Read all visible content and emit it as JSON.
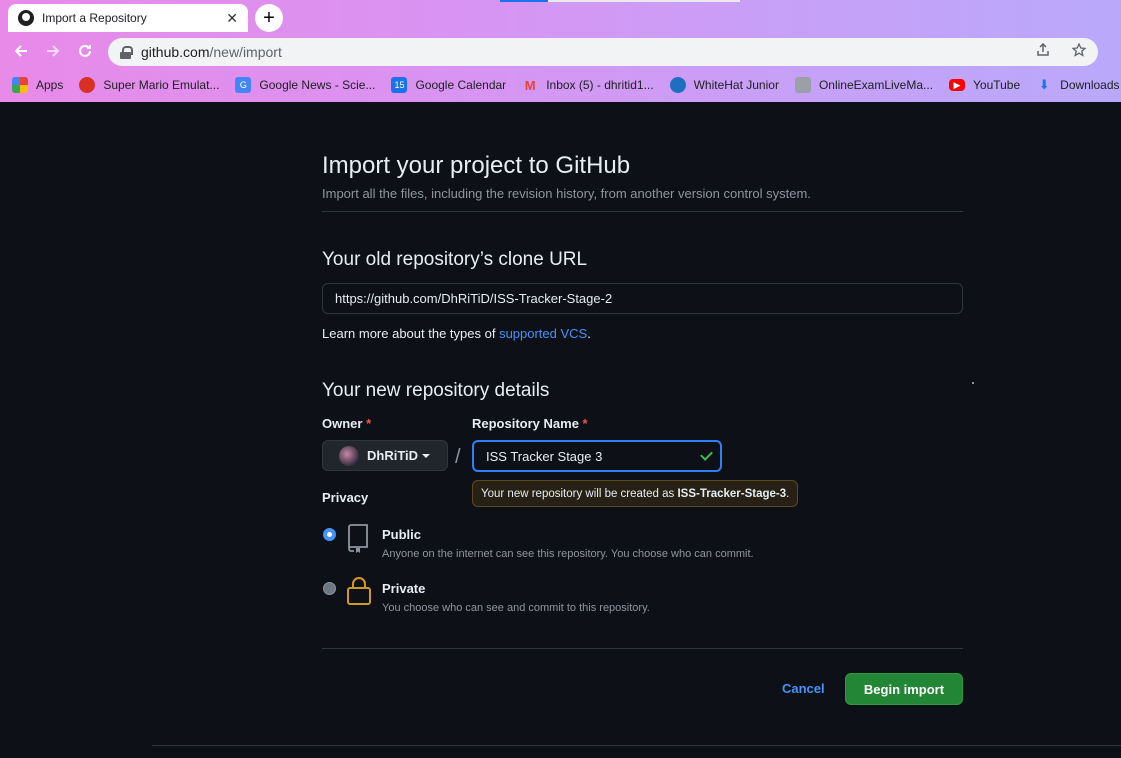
{
  "browser": {
    "tab_title": "Import a Repository",
    "tab_close": "✕",
    "new_tab": "+",
    "url_host": "github.com",
    "url_path": "/new/import",
    "bookmarks": [
      {
        "label": "Apps",
        "icon": "apps-grid-icon",
        "color": "#e8453c"
      },
      {
        "label": "Super Mario Emulat...",
        "icon": "mario-icon",
        "color": "#f4b400"
      },
      {
        "label": "Google News - Scie...",
        "icon": "google-news-icon",
        "color": "#4285f4"
      },
      {
        "label": "Google Calendar",
        "icon": "google-calendar-icon",
        "color": "#1a73e8"
      },
      {
        "label": "Inbox (5) - dhritid1...",
        "icon": "gmail-icon",
        "color": "#ea4335"
      },
      {
        "label": "WhiteHat Junior",
        "icon": "whitehat-icon",
        "color": "#1f6fbf"
      },
      {
        "label": "OnlineExamLiveMa...",
        "icon": "exam-icon",
        "color": "#9aa0a6"
      },
      {
        "label": "YouTube",
        "icon": "youtube-icon",
        "color": "#ff0000"
      },
      {
        "label": "Downloads",
        "icon": "download-icon",
        "color": "#1a73e8"
      }
    ]
  },
  "page": {
    "title": "Import your project to GitHub",
    "subtitle": "Import all the files, including the revision history, from another version control system.",
    "clone_heading": "Your old repository’s clone URL",
    "clone_url": "https://github.com/DhRiTiD/ISS-Tracker-Stage-2",
    "learn_text": "Learn more about the types of ",
    "learn_link": "supported VCS",
    "learn_end": ".",
    "details_heading": "Your new repository details",
    "owner_label": "Owner",
    "repo_label": "Repository Name",
    "required": "*",
    "owner_name": "DhRiTiD",
    "slash": "/",
    "repo_name": "ISS Tracker Stage 3",
    "hint_prefix": "Your new repository will be created as ",
    "hint_name": "ISS-Tracker-Stage-3",
    "hint_end": ".",
    "privacy_label": "Privacy",
    "public_title": "Public",
    "public_desc": "Anyone on the internet can see this repository. You choose who can commit.",
    "private_title": "Private",
    "private_desc": "You choose who can see and commit to this repository.",
    "cancel_label": "Cancel",
    "begin_label": "Begin import",
    "privacy_selected": "Public"
  },
  "colors": {
    "accent": "#4493f8",
    "success": "#238636",
    "background": "#0d1117",
    "lock_icon": "#d29922"
  }
}
